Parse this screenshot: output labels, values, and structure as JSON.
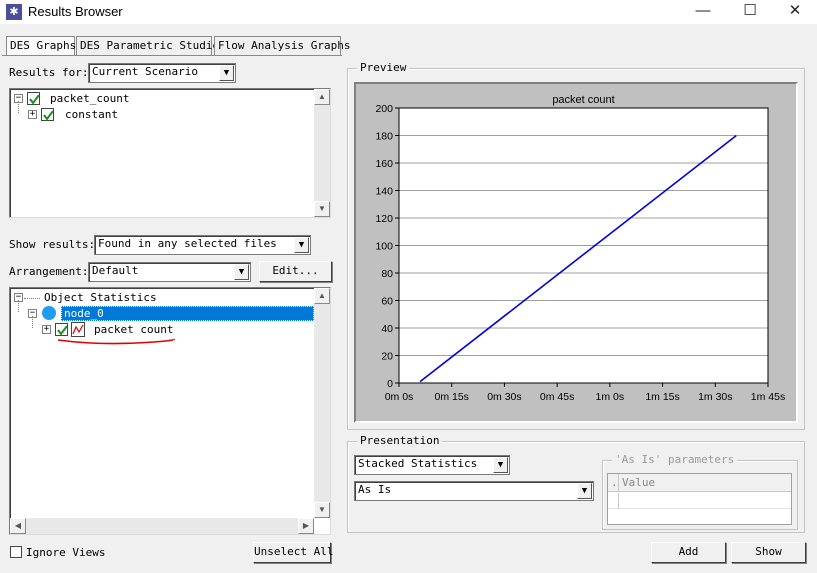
{
  "window": {
    "title": "Results Browser",
    "minimize": "—",
    "maximize": "☐",
    "close": "✕"
  },
  "tabs": [
    {
      "label": "DES Graphs",
      "active": true
    },
    {
      "label": "DES Parametric Studies",
      "active": false
    },
    {
      "label": "Flow Analysis Graphs",
      "active": false
    }
  ],
  "results_for": {
    "label": "Results for:",
    "value": "Current Scenario"
  },
  "results_tree": [
    {
      "label": "packet_count",
      "expander": "−",
      "checked": true
    },
    {
      "label": "constant",
      "expander": "+",
      "checked": true
    }
  ],
  "show_results": {
    "label": "Show results:",
    "value": "Found in any selected files"
  },
  "arrangement": {
    "label": "Arrangement:",
    "value": "Default",
    "edit_button": "Edit..."
  },
  "object_tree": [
    {
      "label": "Object Statistics",
      "expander": "−"
    },
    {
      "label": "node_0",
      "expander": "−",
      "selected": true
    },
    {
      "label": "packet count",
      "expander": "+",
      "checked": true
    }
  ],
  "ignore_views": {
    "label": "Ignore Views",
    "checked": false
  },
  "unselect_all": "Unselect All",
  "preview": {
    "group_label": "Preview"
  },
  "presentation": {
    "group_label": "Presentation",
    "stack_mode": "Stacked Statistics",
    "filter_mode": "As Is",
    "params_group_label": "'As Is' parameters",
    "params_header_marker": ".",
    "params_header_value": "Value",
    "add_button": "Add",
    "show_button": "Show"
  },
  "colors": {
    "line": "#0000e0",
    "selection": "#0078d7",
    "annotation": "#e00000",
    "node_icon": "#1e9cf0"
  },
  "chart_data": {
    "type": "line",
    "title": "packet count",
    "xlabel": "",
    "ylabel": "",
    "x_ticks": [
      "0m 0s",
      "0m 15s",
      "0m 30s",
      "0m 45s",
      "1m 0s",
      "1m 15s",
      "1m 30s",
      "1m 45s"
    ],
    "y_ticks": [
      "0",
      "20",
      "40",
      "60",
      "80",
      "100",
      "120",
      "140",
      "160",
      "180",
      "200"
    ],
    "xlim_seconds": [
      0,
      105
    ],
    "ylim": [
      0,
      200
    ],
    "grid": "horizontal",
    "series": [
      {
        "x_seconds": [
          6,
          96
        ],
        "y": [
          1,
          180
        ]
      }
    ]
  }
}
